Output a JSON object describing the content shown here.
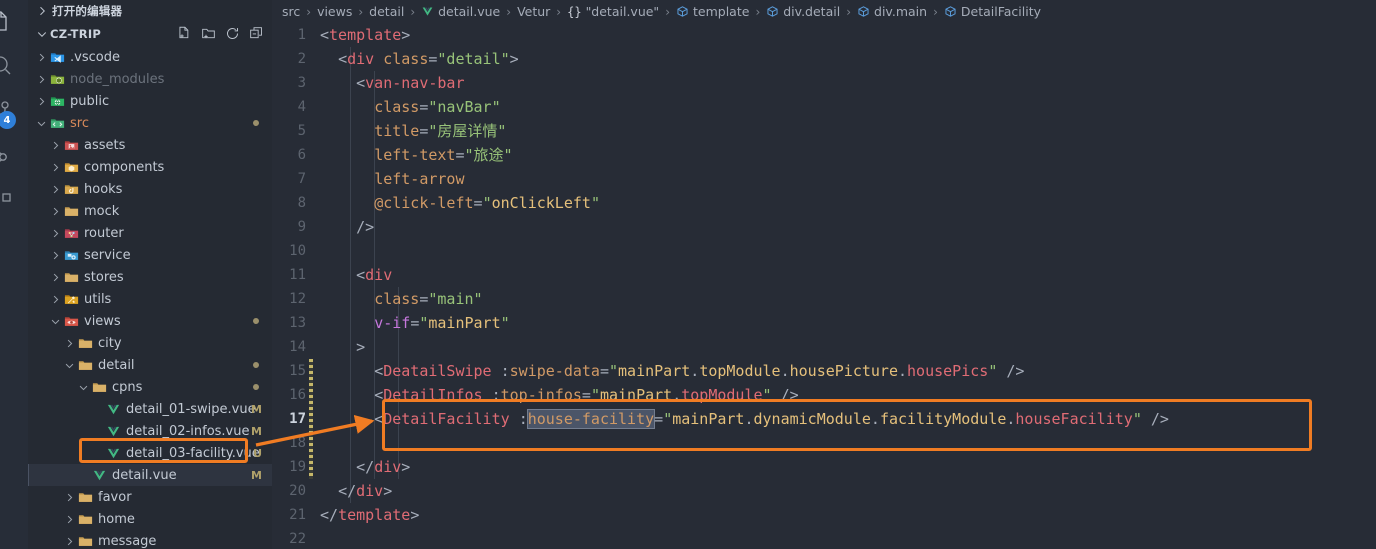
{
  "activity_bar": {
    "items": [
      {
        "name": "explorer-icon",
        "glyph": "files"
      },
      {
        "name": "search-icon",
        "glyph": "search"
      },
      {
        "name": "source-control-icon",
        "glyph": "source-control",
        "badge": "4"
      },
      {
        "name": "run-debug-icon",
        "glyph": "run-debug"
      },
      {
        "name": "extensions-icon",
        "glyph": "extensions"
      }
    ]
  },
  "sidebar": {
    "open_editors_label": "打开的编辑器",
    "project_name": "CZ-TRIP",
    "actions": [
      {
        "name": "new-file-button",
        "title": "New File"
      },
      {
        "name": "new-folder-button",
        "title": "New Folder"
      },
      {
        "name": "refresh-explorer-button",
        "title": "Refresh Explorer"
      },
      {
        "name": "collapse-folders-button",
        "title": "Collapse Folders"
      }
    ],
    "tree": [
      {
        "label": ".vscode",
        "depth": 1,
        "type": "folder",
        "state": "collapsed",
        "icon": "vscode-folder",
        "style": "normal"
      },
      {
        "label": "node_modules",
        "depth": 1,
        "type": "folder",
        "state": "collapsed",
        "icon": "node-folder",
        "style": "dim"
      },
      {
        "label": "public",
        "depth": 1,
        "type": "folder",
        "state": "collapsed",
        "icon": "public-folder",
        "style": "normal"
      },
      {
        "label": "src",
        "depth": 1,
        "type": "folder",
        "state": "expanded",
        "icon": "src-folder",
        "style": "src-mod",
        "dot": true
      },
      {
        "label": "assets",
        "depth": 2,
        "type": "folder",
        "state": "collapsed",
        "icon": "assets-folder",
        "style": "normal"
      },
      {
        "label": "components",
        "depth": 2,
        "type": "folder",
        "state": "collapsed",
        "icon": "components-folder",
        "style": "normal"
      },
      {
        "label": "hooks",
        "depth": 2,
        "type": "folder",
        "state": "collapsed",
        "icon": "hooks-folder",
        "style": "normal"
      },
      {
        "label": "mock",
        "depth": 2,
        "type": "folder",
        "state": "collapsed",
        "icon": "plain-folder",
        "style": "normal"
      },
      {
        "label": "router",
        "depth": 2,
        "type": "folder",
        "state": "collapsed",
        "icon": "router-folder",
        "style": "normal"
      },
      {
        "label": "service",
        "depth": 2,
        "type": "folder",
        "state": "collapsed",
        "icon": "service-folder",
        "style": "normal"
      },
      {
        "label": "stores",
        "depth": 2,
        "type": "folder",
        "state": "collapsed",
        "icon": "plain-folder",
        "style": "normal"
      },
      {
        "label": "utils",
        "depth": 2,
        "type": "folder",
        "state": "collapsed",
        "icon": "utils-folder",
        "style": "normal"
      },
      {
        "label": "views",
        "depth": 2,
        "type": "folder",
        "state": "expanded",
        "icon": "views-folder",
        "style": "normal",
        "dot": true
      },
      {
        "label": "city",
        "depth": 3,
        "type": "folder",
        "state": "collapsed",
        "icon": "plain-folder",
        "style": "normal"
      },
      {
        "label": "detail",
        "depth": 3,
        "type": "folder",
        "state": "expanded",
        "icon": "plain-folder",
        "style": "normal",
        "dot": true
      },
      {
        "label": "cpns",
        "depth": 4,
        "type": "folder",
        "state": "expanded",
        "icon": "plain-folder",
        "style": "normal",
        "dot": true
      },
      {
        "label": "detail_01-swipe.vue",
        "depth": 5,
        "type": "file",
        "icon": "vue-file",
        "style": "normal",
        "badge": "M"
      },
      {
        "label": "detail_02-infos.vue",
        "depth": 5,
        "type": "file",
        "icon": "vue-file",
        "style": "normal",
        "badge": "M"
      },
      {
        "label": "detail_03-facility.vue",
        "depth": 5,
        "type": "file",
        "icon": "vue-file",
        "style": "normal",
        "badge": "U",
        "highlighted": true
      },
      {
        "label": "detail.vue",
        "depth": 4,
        "type": "file",
        "icon": "vue-file",
        "style": "normal",
        "badge": "M",
        "selected": true
      },
      {
        "label": "favor",
        "depth": 3,
        "type": "folder",
        "state": "collapsed",
        "icon": "plain-folder",
        "style": "normal"
      },
      {
        "label": "home",
        "depth": 3,
        "type": "folder",
        "state": "collapsed",
        "icon": "plain-folder",
        "style": "normal"
      },
      {
        "label": "message",
        "depth": 3,
        "type": "folder",
        "state": "collapsed",
        "icon": "plain-folder",
        "style": "normal"
      }
    ]
  },
  "breadcrumb": {
    "items": [
      {
        "label": "src",
        "icon": "none"
      },
      {
        "label": "views",
        "icon": "none"
      },
      {
        "label": "detail",
        "icon": "none"
      },
      {
        "label": "detail.vue",
        "icon": "vue-icon"
      },
      {
        "label": "Vetur",
        "icon": "none"
      },
      {
        "label": "\"detail.vue\"",
        "icon": "braces-icon"
      },
      {
        "label": "template",
        "icon": "symbol-cube-icon"
      },
      {
        "label": "div.detail",
        "icon": "symbol-cube-icon"
      },
      {
        "label": "div.main",
        "icon": "symbol-cube-icon"
      },
      {
        "label": "DetailFacility",
        "icon": "symbol-cube-icon"
      }
    ],
    "separator": "›"
  },
  "editor": {
    "active_line": 17,
    "lines": [
      {
        "n": 1,
        "text": "<template>"
      },
      {
        "n": 2,
        "text": "  <div class=\"detail\">"
      },
      {
        "n": 3,
        "text": "    <van-nav-bar"
      },
      {
        "n": 4,
        "text": "      class=\"navBar\""
      },
      {
        "n": 5,
        "text": "      title=\"房屋详情\""
      },
      {
        "n": 6,
        "text": "      left-text=\"旅途\""
      },
      {
        "n": 7,
        "text": "      left-arrow"
      },
      {
        "n": 8,
        "text": "      @click-left=\"onClickLeft\""
      },
      {
        "n": 9,
        "text": "    />"
      },
      {
        "n": 10,
        "text": ""
      },
      {
        "n": 11,
        "text": "    <div"
      },
      {
        "n": 12,
        "text": "      class=\"main\""
      },
      {
        "n": 13,
        "text": "      v-if=\"mainPart\""
      },
      {
        "n": 14,
        "text": "    >"
      },
      {
        "n": 15,
        "text": "      <DeatailSwipe :swipe-data=\"mainPart.topModule.housePicture.housePics\" />"
      },
      {
        "n": 16,
        "text": "      <DetailInfos :top-infos=\"mainPart.topModule\" />"
      },
      {
        "n": 17,
        "text": "      <DetailFacility :house-facility=\"mainPart.dynamicModule.facilityModule.houseFacility\" />"
      },
      {
        "n": 18,
        "text": ""
      },
      {
        "n": 19,
        "text": "    </div>"
      },
      {
        "n": 20,
        "text": "  </div>"
      },
      {
        "n": 21,
        "text": "</template>"
      },
      {
        "n": 22,
        "text": ""
      }
    ],
    "selection": "house-facility"
  },
  "annotations": {
    "color": "#f07c23",
    "file_box_target": "detail_03-facility.vue",
    "code_box_target_line": 17,
    "arrow": "points from detail_03-facility.vue in explorer to line 17 DetailFacility usage"
  }
}
